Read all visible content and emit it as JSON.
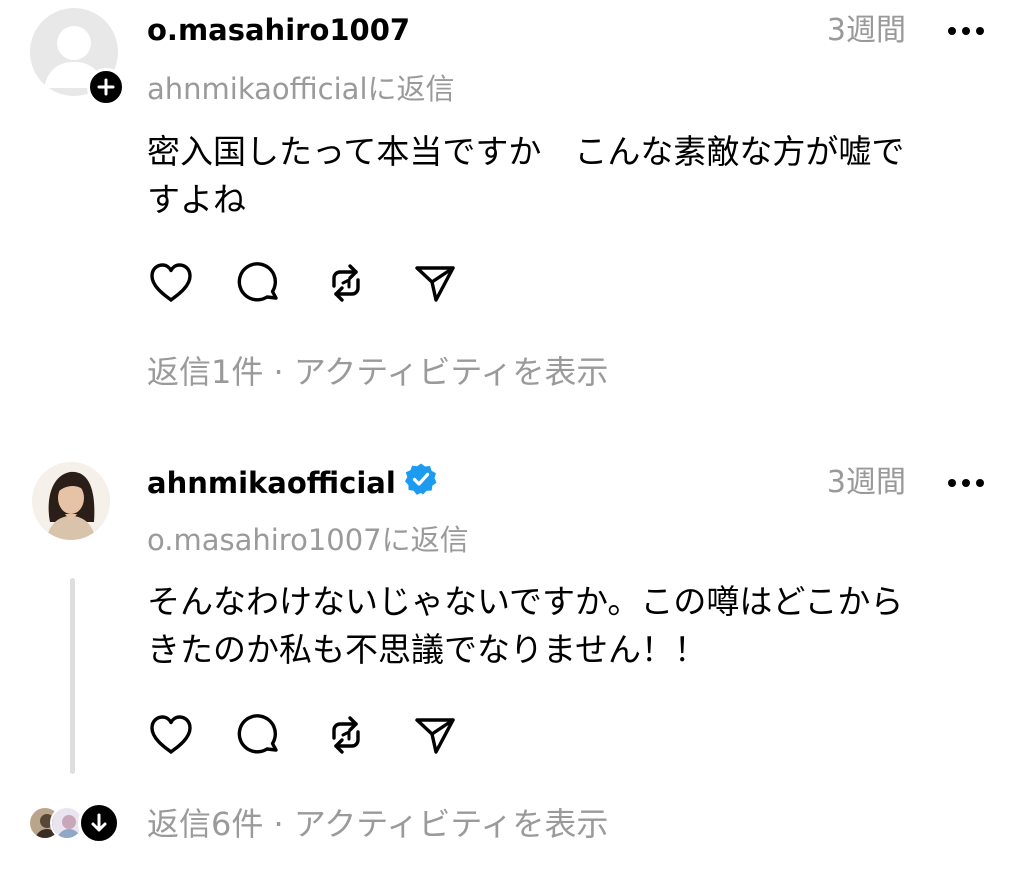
{
  "comments": [
    {
      "username": "o.masahiro1007",
      "time": "3週間",
      "reply_to": "ahnmikaofficialに返信",
      "body_line1": "密入国したって本当ですか　こんな素敵な方が嘘で",
      "body_line2": "すよね",
      "view_replies": "返信1件 · アクティビティを表示",
      "verified": false
    },
    {
      "username": "ahnmikaofficial",
      "time": "3週間",
      "reply_to": "o.masahiro1007に返信",
      "body_line1": "そんなわけないじゃないですか。この噂はどこから",
      "body_line2": "きたのか私も不思議でなりません！！",
      "view_replies": "返信6件 · アクティビティを表示",
      "verified": true
    }
  ],
  "icons": {
    "like": "heart-icon",
    "comment": "comment-icon",
    "repost": "repost-icon",
    "share": "send-icon",
    "more": "more-icon",
    "follow": "plus-icon",
    "verified": "verified-badge-icon",
    "expand": "arrow-down-icon"
  },
  "colors": {
    "verified_blue": "#1d9bf0",
    "muted_text": "#999999",
    "thread_line": "#dedede"
  }
}
